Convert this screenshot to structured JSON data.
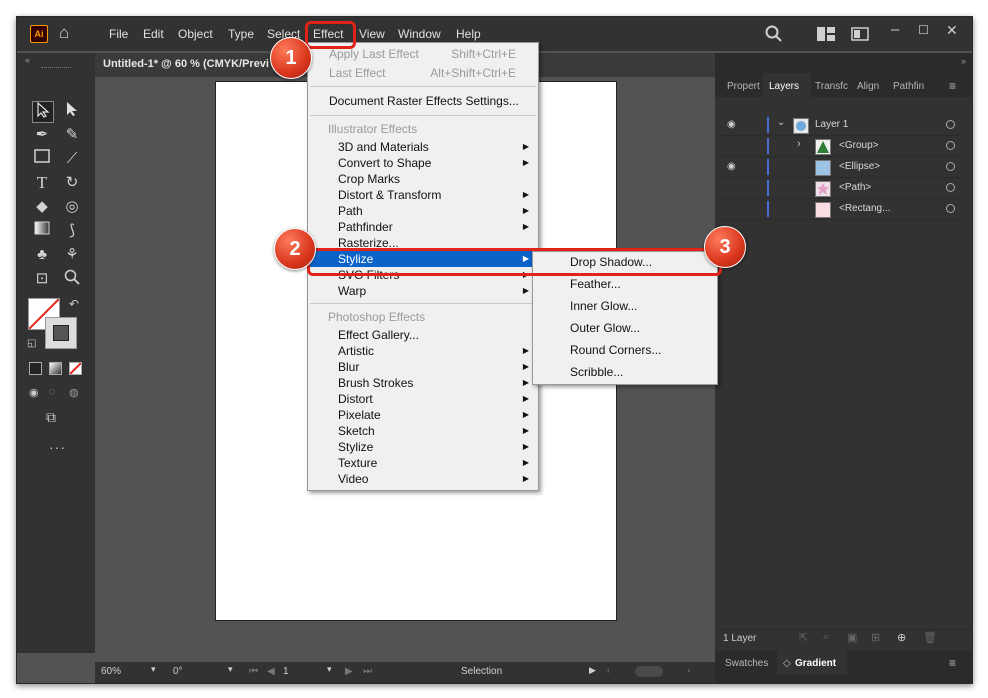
{
  "app": {
    "logo": "Ai"
  },
  "menubar": {
    "items": [
      "File",
      "Edit",
      "Object",
      "Type",
      "Select",
      "Effect",
      "View",
      "Window",
      "Help"
    ]
  },
  "icons": {
    "home": "home-icon",
    "search": "search-icon",
    "workspace": "workspace-icon",
    "panels": "panels-icon",
    "minimize": "minimize-icon",
    "maximize": "maximize-icon",
    "close": "close-icon"
  },
  "document": {
    "tab_title": "Untitled-1* @ 60 % (CMYK/Previ"
  },
  "status": {
    "zoom": "60%",
    "rotation": "0°",
    "artboard": "1",
    "tool": "Selection"
  },
  "effect_menu": {
    "apply_last": {
      "label": "Apply Last Effect",
      "shortcut": "Shift+Ctrl+E"
    },
    "last_effect": {
      "label": "Last Effect",
      "shortcut": "Alt+Shift+Ctrl+E"
    },
    "raster_settings": "Document Raster Effects Settings...",
    "illustrator_header": "Illustrator Effects",
    "illustrator_items": [
      "3D and Materials",
      "Convert to Shape",
      "Crop Marks",
      "Distort & Transform",
      "Path",
      "Pathfinder",
      "Rasterize...",
      "Stylize",
      "SVG Filters",
      "Warp"
    ],
    "photoshop_header": "Photoshop Effects",
    "photoshop_items": [
      "Effect Gallery...",
      "Artistic",
      "Blur",
      "Brush Strokes",
      "Distort",
      "Pixelate",
      "Sketch",
      "Stylize",
      "Texture",
      "Video"
    ]
  },
  "stylize_submenu": {
    "items": [
      "Drop Shadow...",
      "Feather...",
      "Inner Glow...",
      "Outer Glow...",
      "Round Corners...",
      "Scribble..."
    ]
  },
  "panel": {
    "tabs": [
      "Propert",
      "Layers",
      "Transfc",
      "Align",
      "Pathfin"
    ],
    "layers": [
      {
        "name": "Layer 1"
      },
      {
        "name": "<Group>"
      },
      {
        "name": "<Ellipse>"
      },
      {
        "name": "<Path>"
      },
      {
        "name": "<Rectang..."
      }
    ],
    "layer_count": "1 Layer",
    "bottom_tabs": [
      "Swatches",
      "Gradient"
    ]
  },
  "callouts": [
    "1",
    "2",
    "3"
  ]
}
